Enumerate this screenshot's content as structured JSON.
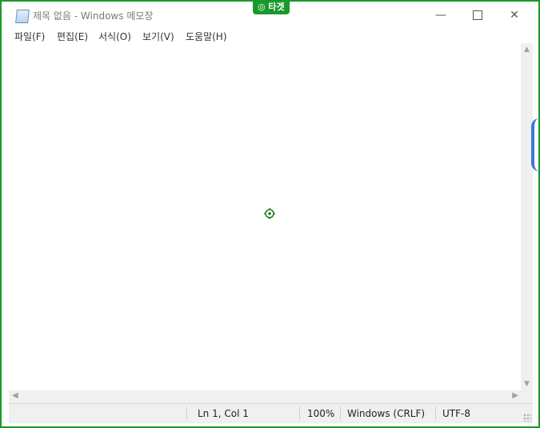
{
  "badge": {
    "label": "◎ 타겟"
  },
  "window": {
    "title": "제목 없음 - Windows 메모장",
    "controls": {
      "minimize": "—",
      "maximize": "",
      "close": "✕"
    }
  },
  "menu": [
    {
      "label": "파일(F)"
    },
    {
      "label": "편집(E)"
    },
    {
      "label": "서식(O)"
    },
    {
      "label": "보기(V)"
    },
    {
      "label": "도움말(H)"
    }
  ],
  "editor": {
    "content": ""
  },
  "scrollbars": {
    "up": "▲",
    "down": "▼",
    "left": "◀",
    "right": "▶"
  },
  "status": {
    "position": "Ln 1, Col 1",
    "zoom": "100%",
    "line_ending": "Windows (CRLF)",
    "encoding": "UTF-8"
  },
  "colors": {
    "frame": "#1a9a2a",
    "badge": "#179a2b",
    "marker": "#1a7a1a"
  }
}
